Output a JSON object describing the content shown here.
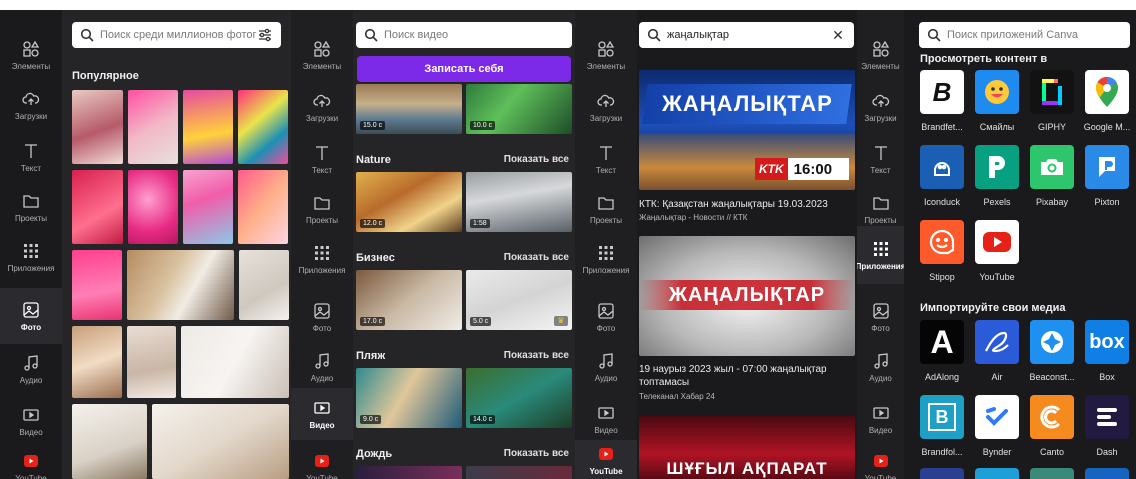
{
  "rail": {
    "elements": "Элементы",
    "uploads": "Загрузки",
    "text": "Текст",
    "projects": "Проекты",
    "apps": "Приложения",
    "photos": "Фото",
    "audio": "Аудио",
    "video": "Видео",
    "youtube": "YouTube"
  },
  "panel1": {
    "search_placeholder": "Поиск среди миллионов фотографий",
    "section_popular": "Популярное"
  },
  "panel2": {
    "search_placeholder": "Поиск видео",
    "record_button": "Записать себя",
    "top_durations": [
      "15.0 с",
      "10.0 с"
    ],
    "categories": [
      {
        "title": "Nature",
        "show_all": "Показать все",
        "durations": [
          "12.0 с",
          "1:58"
        ]
      },
      {
        "title": "Бизнес",
        "show_all": "Показать все",
        "durations": [
          "17.0 с",
          "5.0 с"
        ]
      },
      {
        "title": "Пляж",
        "show_all": "Показать все",
        "durations": [
          "9.0 с",
          "14.0 с"
        ]
      },
      {
        "title": "Дождь",
        "show_all": "Показать все",
        "durations": []
      }
    ]
  },
  "panel3": {
    "search_value": "жаңалықтар",
    "news": [
      {
        "title": "КТК: Қазақстан жаңалықтары 19.03.2023",
        "sub": "Жаңалықтар - Новости // КТК",
        "banner": "ЖАҢАЛЫҚТАР",
        "channel": "KTK",
        "time": "16:00"
      },
      {
        "title": "19 наурыз 2023 жыл - 07:00 жаңалықтар топтамасы",
        "sub": "Телеканал Хабар 24",
        "banner": "ЖАҢАЛЫҚТАР"
      },
      {
        "title": "",
        "sub": "",
        "banner": "ШҰҒЫЛ АҚПАРАТ"
      }
    ]
  },
  "panel4": {
    "search_placeholder": "Поиск приложений Canva",
    "section_browse": "Просмотреть контент в",
    "section_import": "Импортируйте свои медиа",
    "apps_row1": [
      "Brandfet...",
      "Смайлы",
      "GIPHY",
      "Google M..."
    ],
    "apps_row2": [
      "Iconduck",
      "Pexels",
      "Pixabay",
      "Pixton"
    ],
    "apps_row3": [
      "Stipop",
      "YouTube"
    ],
    "apps_row4": [
      "AdAlong",
      "Air",
      "Beaconst...",
      "Box"
    ],
    "apps_row5": [
      "Brandfol...",
      "Bynder",
      "Canto",
      "Dash"
    ],
    "tile_glyphs": {
      "adalong": "A",
      "box": "box",
      "brandfolder": "B",
      "brandfetch": "B"
    }
  },
  "colors": {
    "accent_purple": "#7d2ae8",
    "panel_dark": "#1a1a1d",
    "content_bg": "#252528"
  }
}
